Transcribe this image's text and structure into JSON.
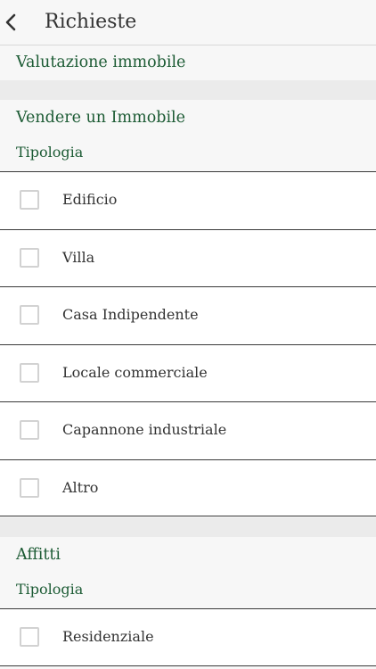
{
  "header": {
    "title": "Richieste",
    "back_icon": "chevron-left-icon"
  },
  "valutazione": {
    "label": "Valutazione immobile"
  },
  "vendere": {
    "label": "Vendere un Immobile",
    "sub_label": "Tipologia",
    "items": [
      {
        "label": "Edificio",
        "checked": false
      },
      {
        "label": "Villa",
        "checked": false
      },
      {
        "label": "Casa Indipendente",
        "checked": false
      },
      {
        "label": "Locale commerciale",
        "checked": false
      },
      {
        "label": "Capannone industriale",
        "checked": false
      },
      {
        "label": "Altro",
        "checked": false
      }
    ]
  },
  "affitti": {
    "label": "Affitti",
    "sub_label": "Tipologia",
    "items": [
      {
        "label": "Residenziale",
        "checked": false
      }
    ]
  },
  "colors": {
    "accent_green": "#1c5b34",
    "text": "#333333",
    "background": "#f7f7f7",
    "divider": "#3a3a3a"
  }
}
